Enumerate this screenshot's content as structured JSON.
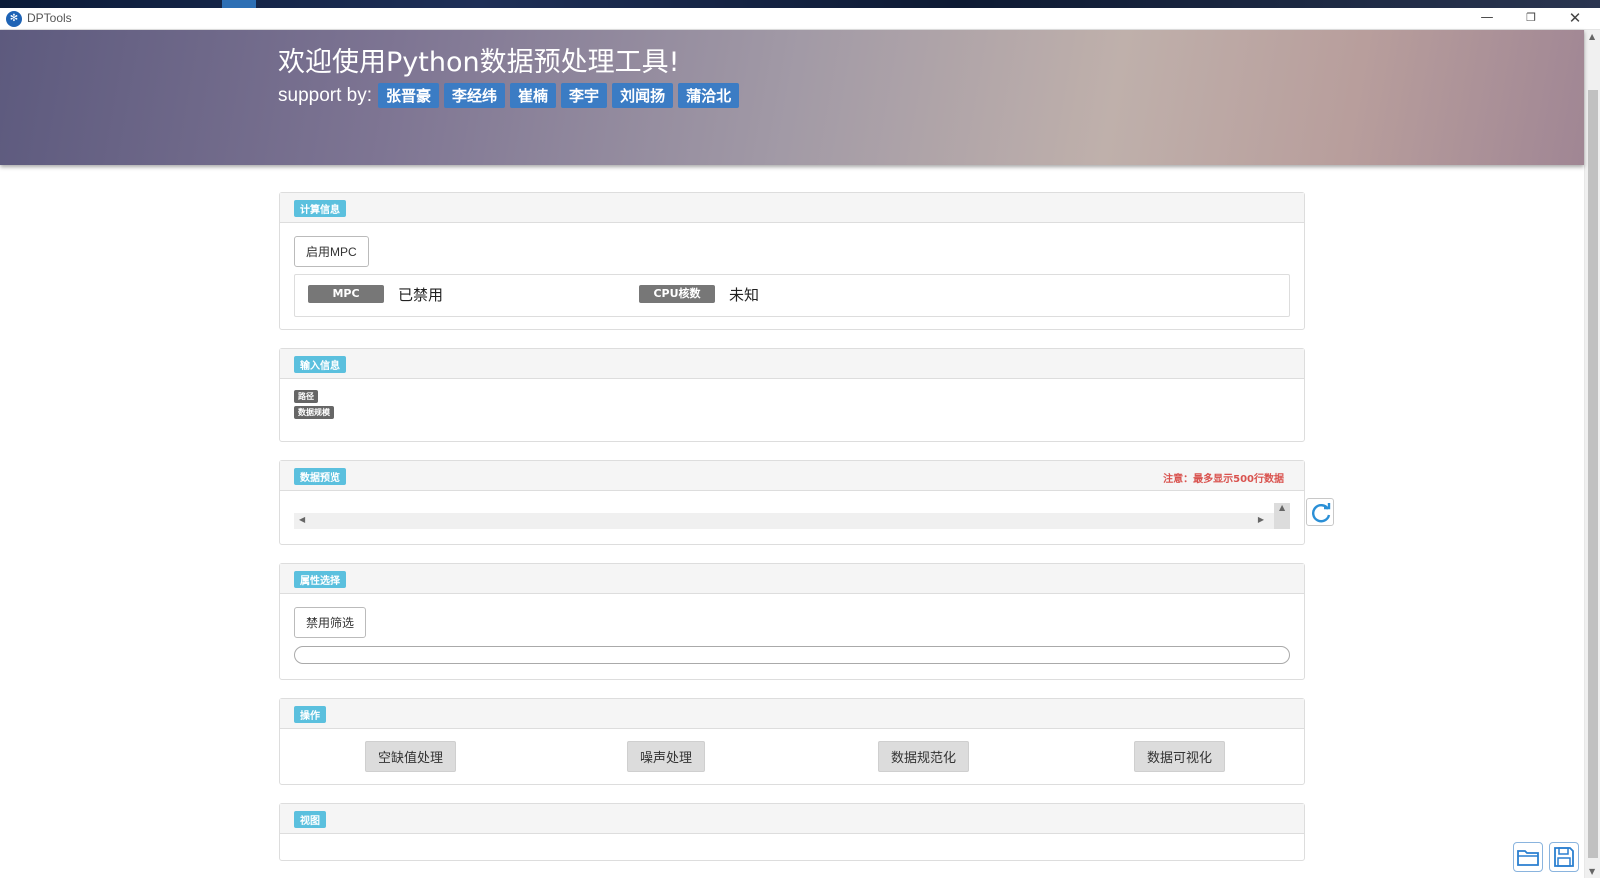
{
  "window": {
    "title": "DPTools",
    "minimize": "—",
    "maximize": "❐",
    "close": "✕"
  },
  "header": {
    "title": "欢迎使用Python数据预处理工具!",
    "support_label": "support by:",
    "authors": [
      "张晋豪",
      "李经纬",
      "崔楠",
      "李宇",
      "刘闻扬",
      "蒲洽北"
    ]
  },
  "compute": {
    "tag": "计算信息",
    "enable_button": "启用MPC",
    "mpc_label": "MPC",
    "mpc_value": "已禁用",
    "cpu_label": "CPU核数",
    "cpu_value": "未知"
  },
  "input": {
    "tag": "输入信息",
    "path_label": "路径",
    "scale_label": "数据规模"
  },
  "preview": {
    "tag": "数据预览",
    "note": "注意：最多显示500行数据"
  },
  "attributes": {
    "tag": "属性选择",
    "filter_button": "禁用筛选"
  },
  "operations": {
    "tag": "操作",
    "buttons": [
      "空缺值处理",
      "噪声处理",
      "数据规范化",
      "数据可视化"
    ]
  },
  "view": {
    "tag": "视图"
  },
  "icons": {
    "app": "app-logo-icon",
    "refresh": "refresh-icon",
    "open": "folder-open-icon",
    "save": "save-icon"
  },
  "colors": {
    "tag_blue": "#5bc0de",
    "author_blue": "#3b7cc4",
    "warning_red": "#d9534f",
    "label_grey": "#777777"
  }
}
